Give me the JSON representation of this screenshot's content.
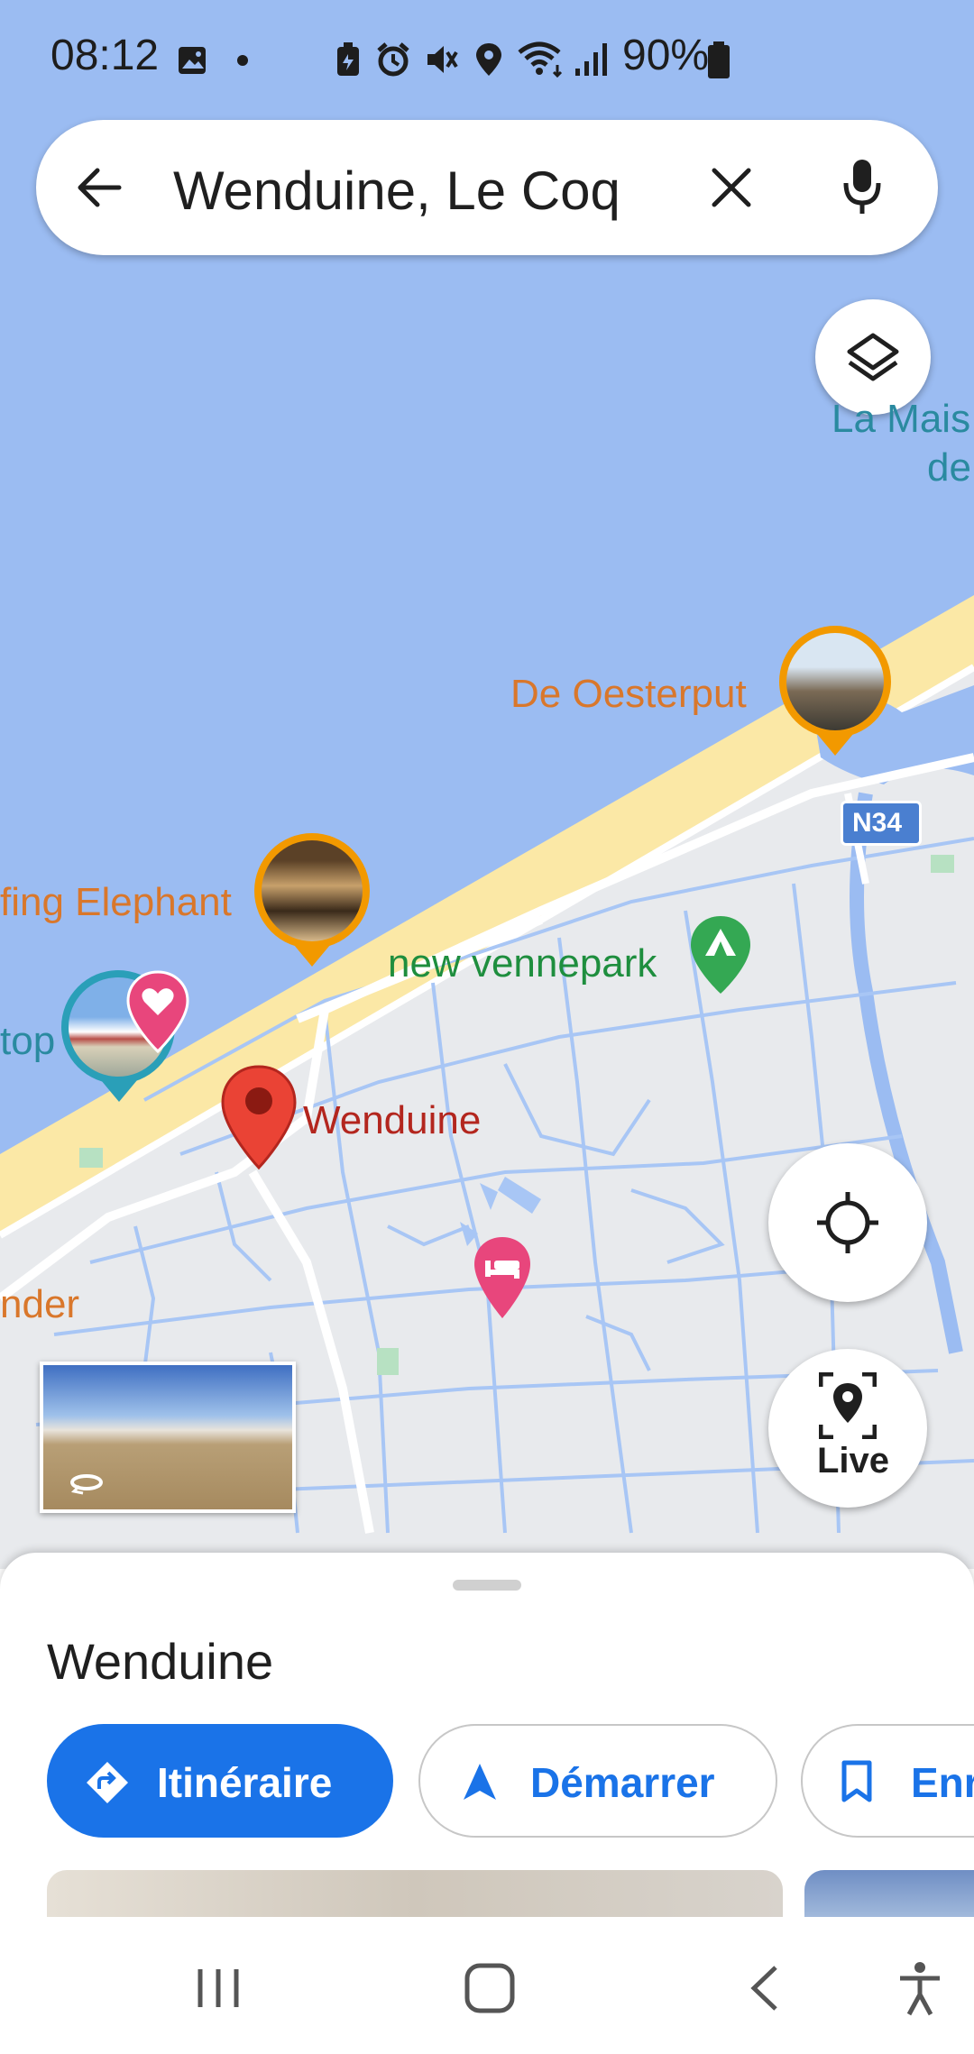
{
  "status_bar": {
    "time": "08:12",
    "battery": "90%",
    "icons": [
      "gallery-icon",
      "dot-icon",
      "battery-saver-icon",
      "alarm-icon",
      "mute-icon",
      "location-icon",
      "wifi-icon",
      "signal-icon",
      "battery-icon"
    ]
  },
  "search": {
    "query": "Wenduine, Le Coq",
    "back_icon": "arrow-left-icon",
    "clear_icon": "close-icon",
    "mic_icon": "microphone-icon"
  },
  "map": {
    "layers_icon": "layers-icon",
    "labels": {
      "la_maison_1": "La Mais",
      "la_maison_2": "de",
      "de_oesterput": "De Oesterput",
      "road_n34": "N34",
      "elephant": "fing Elephant",
      "vennepark": "new vennepark",
      "top": "top",
      "wenduine": "Wenduine",
      "nder": "nder"
    },
    "colors": {
      "water": "#9bbcf2",
      "land": "#e8eaed",
      "beach": "#fbe8a6",
      "streets": "#a8c6f5",
      "poi_orange": "#f29900",
      "poi_pink": "#e8467c",
      "park_green": "#34a853",
      "pin_red": "#ea4335"
    }
  },
  "controls": {
    "locate_icon": "my-location-icon",
    "live_label": "Live",
    "live_icon": "live-view-icon"
  },
  "sheet": {
    "title": "Wenduine",
    "directions_label": "Itinéraire",
    "start_label": "Démarrer",
    "save_label": "Enr"
  },
  "nav": {
    "recents_icon": "recents-icon",
    "home_icon": "home-icon",
    "back_icon": "back-icon",
    "accessibility_icon": "accessibility-icon"
  }
}
